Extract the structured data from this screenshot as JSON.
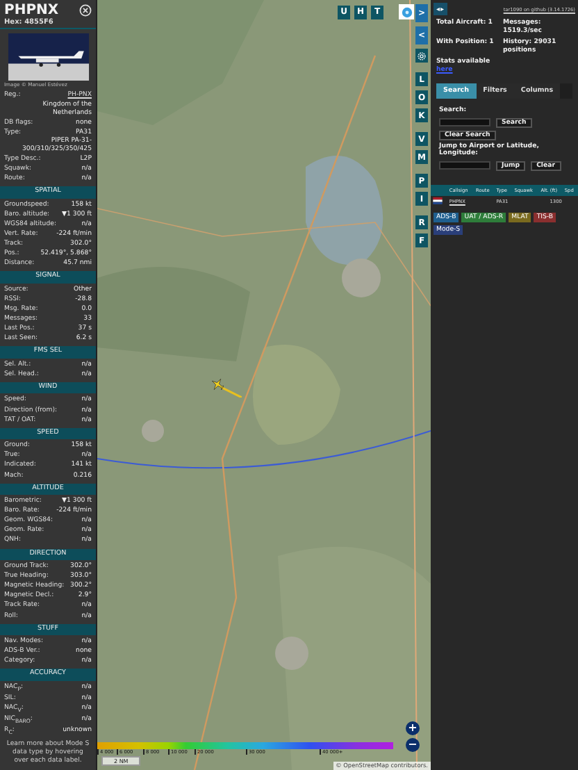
{
  "aircraft": {
    "callsign": "PHPNX",
    "hex_label": "Hex:",
    "hex": "4855F6",
    "photo_credit": "Image © Manuel Estévez",
    "info": [
      {
        "kind": "link",
        "label": "Reg.:",
        "value": "PH-PNX"
      },
      {
        "kind": "note",
        "value": "Kingdom of the Netherlands"
      },
      {
        "kind": "pair",
        "label": "DB flags:",
        "value": "none"
      },
      {
        "kind": "pair",
        "label": "Type:",
        "value": "PA31"
      },
      {
        "kind": "note",
        "value": "PIPER PA-31-300/310/325/350/425"
      },
      {
        "kind": "pair",
        "label": "Type Desc.:",
        "value": "L2P"
      },
      {
        "kind": "pair",
        "label": "Squawk:",
        "value": "n/a"
      },
      {
        "kind": "pair",
        "label": "Route:",
        "value": "n/a"
      }
    ],
    "sections": [
      {
        "title": "SPATIAL",
        "rows": [
          {
            "label": "Groundspeed:",
            "value": "158 kt"
          },
          {
            "label": "Baro. altitude:",
            "value": "▼1 300 ft"
          },
          {
            "label": "WGS84 altitude:",
            "value": "n/a"
          },
          {
            "label": "Vert. Rate:",
            "value": "-224 ft/min"
          },
          {
            "label": "Track:",
            "value": "302.0°"
          },
          {
            "label": "Pos.:",
            "value": "52.419°, 5.868°"
          },
          {
            "label": "Distance:",
            "value": "45.7 nmi"
          }
        ]
      },
      {
        "title": "SIGNAL",
        "rows": [
          {
            "label": "Source:",
            "value": "Other"
          },
          {
            "label": "RSSI:",
            "value": "-28.8"
          },
          {
            "label": "Msg. Rate:",
            "value": "0.0"
          },
          {
            "label": "Messages:",
            "value": "33"
          },
          {
            "label": "Last Pos.:",
            "value": "37 s"
          },
          {
            "label": "Last Seen:",
            "value": "6.2 s"
          }
        ]
      },
      {
        "title": "FMS SEL",
        "rows": [
          {
            "label": "Sel. Alt.:",
            "value": "n/a"
          },
          {
            "label": "Sel. Head.:",
            "value": "n/a"
          }
        ]
      },
      {
        "title": "WIND",
        "rows": [
          {
            "label": "Speed:",
            "value": "n/a"
          },
          {
            "label": "Direction (from):",
            "value": "n/a"
          },
          {
            "label": "TAT / OAT:",
            "value": "n/a"
          }
        ]
      },
      {
        "title": "SPEED",
        "rows": [
          {
            "label": "Ground:",
            "value": "158 kt"
          },
          {
            "label": "True:",
            "value": "n/a"
          },
          {
            "label": "Indicated:",
            "value": "141 kt"
          },
          {
            "label": "Mach:",
            "value": "0.216"
          }
        ]
      },
      {
        "title": "ALTITUDE",
        "rows": [
          {
            "label": "Barometric:",
            "value": "▼1 300 ft"
          },
          {
            "label": "Baro. Rate:",
            "value": "-224 ft/min"
          },
          {
            "label": "Geom. WGS84:",
            "value": "n/a"
          },
          {
            "label": "Geom. Rate:",
            "value": "n/a"
          },
          {
            "label": "QNH:",
            "value": "n/a"
          }
        ]
      },
      {
        "title": "DIRECTION",
        "rows": [
          {
            "label": "Ground Track:",
            "value": "302.0°"
          },
          {
            "label": "True Heading:",
            "value": "303.0°"
          },
          {
            "label": "Magnetic Heading:",
            "value": "300.2°"
          },
          {
            "label": "Magnetic Decl.:",
            "value": "2.9°"
          },
          {
            "label": "Track Rate:",
            "value": "n/a"
          },
          {
            "label": "Roll:",
            "value": "n/a"
          }
        ]
      },
      {
        "title": "STUFF",
        "rows": [
          {
            "label": "Nav. Modes:",
            "value": "n/a"
          },
          {
            "label": "ADS-B Ver.:",
            "value": "none"
          },
          {
            "label": "Category:",
            "value": "n/a"
          }
        ]
      },
      {
        "title": "ACCURACY",
        "rows": [
          {
            "label": "NAC$_{P}$:",
            "value": "n/a"
          },
          {
            "label": "SIL:",
            "value": "n/a"
          },
          {
            "label": "NAC$_{V}$:",
            "value": "n/a"
          },
          {
            "label": "NIC$_{BARO}$:",
            "value": "n/a"
          },
          {
            "label": "R$_{C}$:",
            "value": "unknown"
          }
        ]
      }
    ],
    "footer": "Learn more about Mode S data type by hovering over each data label."
  },
  "map": {
    "kind": "picture",
    "top_buttons": [
      {
        "label": "U",
        "selected": false
      },
      {
        "label": "H",
        "selected": false
      },
      {
        "label": "T",
        "selected": false
      }
    ],
    "side_buttons": [
      {
        "kind": "arrow",
        "label": ">"
      },
      {
        "kind": "arrow",
        "label": "<"
      },
      {
        "kind": "gear"
      },
      {
        "kind": "letter",
        "label": "L"
      },
      {
        "kind": "letter",
        "label": "O"
      },
      {
        "kind": "letter",
        "label": "K"
      },
      {
        "kind": "letter",
        "label": "V"
      },
      {
        "kind": "letter",
        "label": "M"
      },
      {
        "kind": "letter",
        "label": "P"
      },
      {
        "kind": "letter",
        "label": "I"
      },
      {
        "kind": "letter",
        "label": "R"
      },
      {
        "kind": "letter",
        "label": "F"
      }
    ],
    "zoom_in": "+",
    "zoom_out": "−",
    "altitude_legend": [
      "4 000",
      "6 000",
      "8 000",
      "10 000",
      "20 000",
      "30 000",
      "40 000+"
    ],
    "scale": "2 NM",
    "attribution": "© OpenStreetMap contributors."
  },
  "panel": {
    "toggle": "◂▸",
    "version_link": "tar1090 on github (3.14.1726)",
    "stats": [
      {
        "label": "Total Aircraft: 1"
      },
      {
        "label": "Messages: 1519.3/sec"
      },
      {
        "label": "With Position: 1"
      },
      {
        "label": "History: 29031 positions"
      }
    ],
    "stats_text": "Stats available",
    "stats_link": "here",
    "tabs": [
      {
        "label": "Search",
        "selected": true
      },
      {
        "label": "Filters",
        "selected": false
      },
      {
        "label": "Columns",
        "selected": false
      }
    ],
    "search_label": "Search:",
    "search_button": "Search",
    "clear_search": "Clear Search",
    "jump_label": "Jump to Airport or Latitude, Longitude:",
    "jump_button": "Jump",
    "clear_button": "Clear",
    "table": {
      "columns": [
        "Callsign",
        "Route",
        "Type",
        "Squawk",
        "Alt. (ft)",
        "Spd"
      ],
      "rows": [
        {
          "selected": false,
          "callsign": "PHPNX",
          "type": "PA31",
          "altitude": "1300"
        }
      ]
    },
    "legend": [
      {
        "label": "ADS-B",
        "color": "#1f5f8f"
      },
      {
        "label": "UAT / ADS-R",
        "color": "#2e7d3a"
      },
      {
        "label": "MLAT",
        "color": "#7a6a1e"
      },
      {
        "label": "TIS-B",
        "color": "#8a2f2f"
      },
      {
        "label": "Mode-S",
        "color": "#2a3f7a"
      }
    ]
  }
}
